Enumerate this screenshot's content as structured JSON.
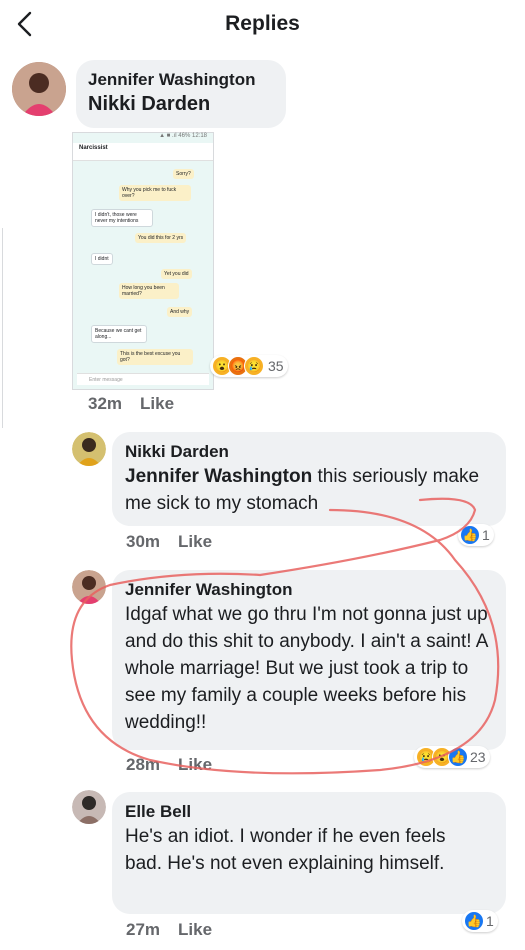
{
  "header": {
    "title": "Replies"
  },
  "comments": [
    {
      "author": "Jennifer Washington",
      "tag": "Nikki Darden",
      "text": "",
      "time": "32m",
      "like_label": "Like",
      "reaction_count": "35"
    },
    {
      "author": "Nikki Darden",
      "tag": "Jennifer Washington",
      "text": " this seriously make me sick to my stomach",
      "time": "30m",
      "like_label": "Like",
      "reaction_count": "1"
    },
    {
      "author": "Jennifer Washington",
      "tag": "",
      "text": "Idgaf what we go thru I'm not gonna just up and do this shit to anybody. I ain't a saint! A whole marriage! But we just took a trip to see my family a couple weeks before his wedding!!",
      "time": "28m",
      "like_label": "Like",
      "reaction_count": "23"
    },
    {
      "author": "Elle Bell",
      "tag": "",
      "text": "He's an idiot. I wonder if he even feels bad. He's not even explaining himself.",
      "time": "27m",
      "like_label": "Like",
      "reaction_count": "1"
    }
  ],
  "screenshot": {
    "contact_name": "Narcissist",
    "messages": [
      {
        "dir": "out",
        "text": "Sorry?"
      },
      {
        "dir": "out",
        "text": "Why you pick me to fuck over?"
      },
      {
        "dir": "in",
        "text": "I didn't, those were never my intentions"
      },
      {
        "dir": "out",
        "text": "You did this for 2 yrs"
      },
      {
        "dir": "in",
        "text": "I didnt"
      },
      {
        "dir": "out",
        "text": "Yet you did"
      },
      {
        "dir": "out",
        "text": "How long you been married?"
      },
      {
        "dir": "out",
        "text": "And why"
      },
      {
        "dir": "in",
        "text": "Because we cant get along..."
      },
      {
        "dir": "out",
        "text": "This is the best excuse you got?"
      }
    ],
    "input_placeholder": "Enter message"
  },
  "colors": {
    "accent": "#1877f2",
    "bubble": "#eff1f3",
    "highlight_circle": "#e8625f"
  }
}
